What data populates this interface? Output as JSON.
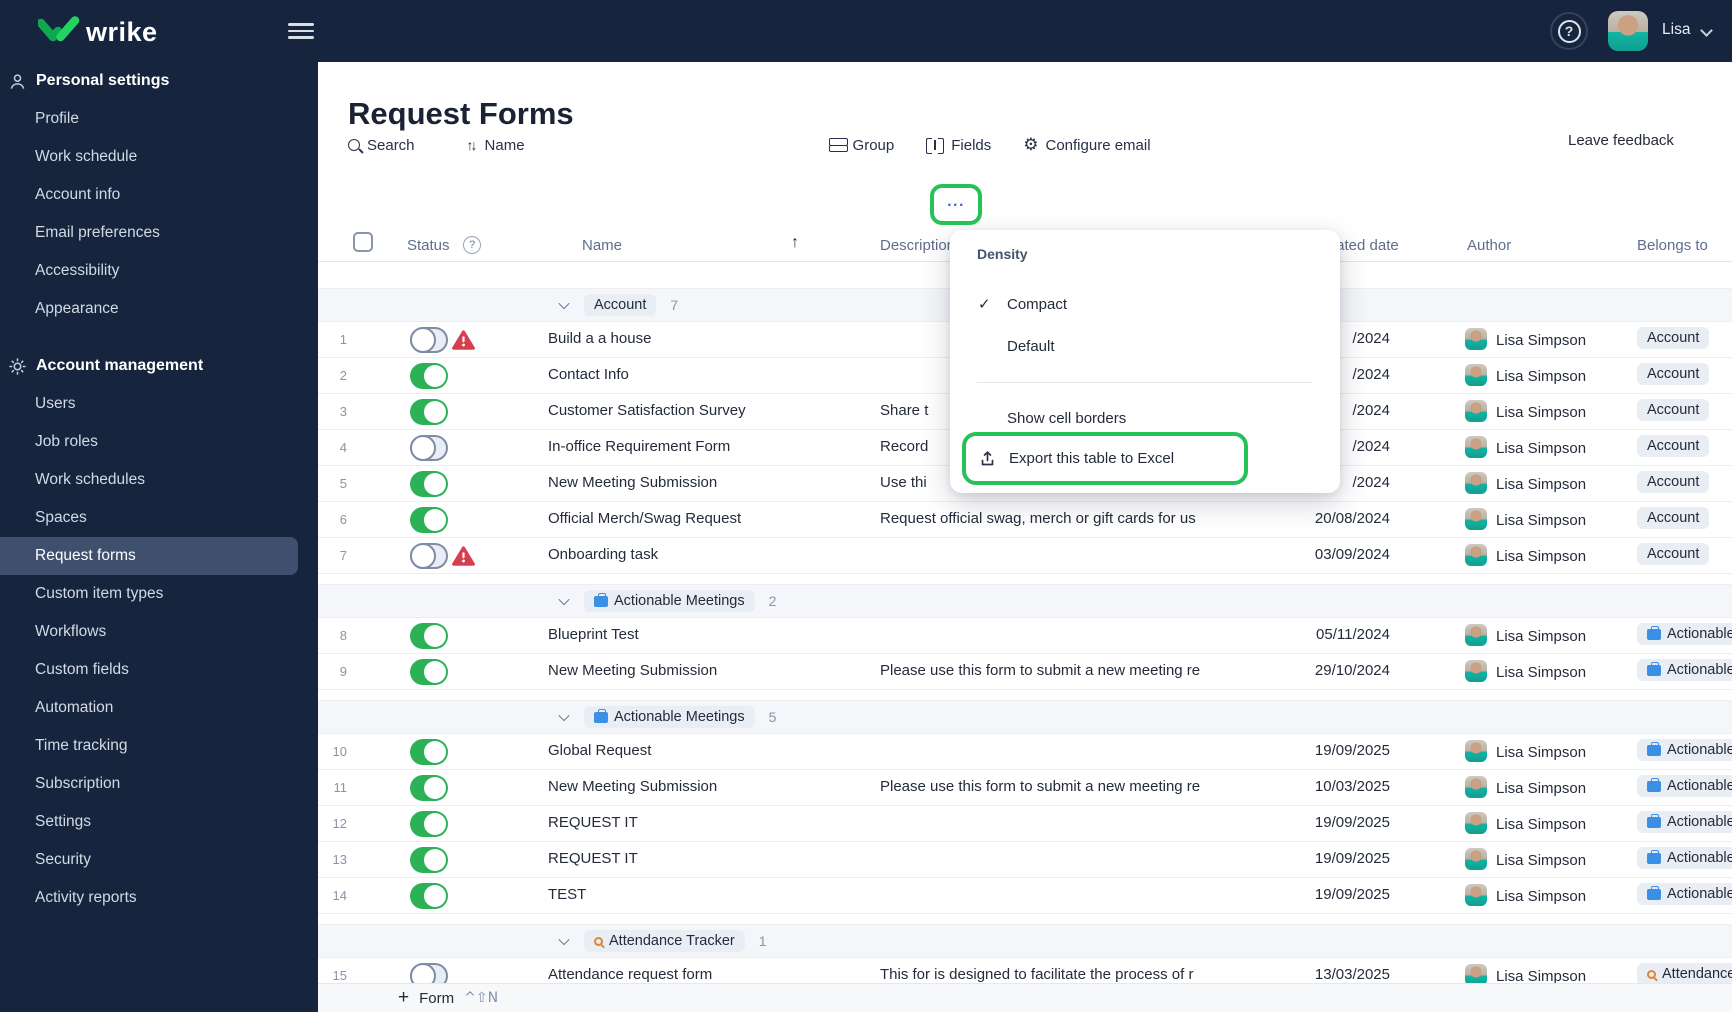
{
  "app": {
    "brand": "wrike",
    "user": {
      "name": "Lisa"
    }
  },
  "sidebar": {
    "sections": [
      {
        "label": "Personal settings",
        "icon": "person-icon",
        "items": [
          {
            "label": "Profile"
          },
          {
            "label": "Work schedule"
          },
          {
            "label": "Account info"
          },
          {
            "label": "Email preferences"
          },
          {
            "label": "Accessibility"
          },
          {
            "label": "Appearance"
          }
        ]
      },
      {
        "label": "Account management",
        "icon": "gear-icon",
        "items": [
          {
            "label": "Users"
          },
          {
            "label": "Job roles"
          },
          {
            "label": "Work schedules"
          },
          {
            "label": "Spaces"
          },
          {
            "label": "Request forms",
            "selected": true
          },
          {
            "label": "Custom item types"
          },
          {
            "label": "Workflows"
          },
          {
            "label": "Custom fields"
          },
          {
            "label": "Automation"
          },
          {
            "label": "Time tracking"
          },
          {
            "label": "Subscription"
          },
          {
            "label": "Settings"
          },
          {
            "label": "Security"
          },
          {
            "label": "Activity reports"
          }
        ]
      }
    ]
  },
  "main": {
    "title": "Request Forms",
    "toolbar": {
      "search": "Search",
      "sort": "Name",
      "group": "Group",
      "fields": "Fields",
      "configure_email": "Configure email",
      "more": "•••",
      "leave_feedback": "Leave feedback"
    },
    "table": {
      "headers": {
        "status": "Status",
        "name": "Name",
        "description": "Description",
        "created_date": "Created date",
        "author": "Author",
        "belongs_to": "Belongs to"
      },
      "groups": [
        {
          "name": "Account",
          "count": "7",
          "icon": null,
          "rows": [
            {
              "num": "1",
              "toggle": "off",
              "warning": true,
              "name": "Build a a house",
              "description": "",
              "date": "/2024",
              "author": "Lisa Simpson",
              "belongs": "Account"
            },
            {
              "num": "2",
              "toggle": "on",
              "warning": false,
              "name": "Contact Info",
              "description": "",
              "date": "/2024",
              "author": "Lisa Simpson",
              "belongs": "Account"
            },
            {
              "num": "3",
              "toggle": "on",
              "warning": false,
              "name": "Customer Satisfaction Survey",
              "description": "Share t",
              "date": "/2024",
              "author": "Lisa Simpson",
              "belongs": "Account"
            },
            {
              "num": "4",
              "toggle": "off",
              "warning": false,
              "name": "In-office Requirement Form",
              "description": "Record",
              "date": "/2024",
              "author": "Lisa Simpson",
              "belongs": "Account"
            },
            {
              "num": "5",
              "toggle": "on",
              "warning": false,
              "name": "New Meeting Submission",
              "description": "Use thi",
              "date": "/2024",
              "author": "Lisa Simpson",
              "belongs": "Account"
            },
            {
              "num": "6",
              "toggle": "on",
              "warning": false,
              "name": "Official Merch/Swag Request",
              "description": "Request official swag, merch or gift cards for us",
              "date": "20/08/2024",
              "author": "Lisa Simpson",
              "belongs": "Account"
            },
            {
              "num": "7",
              "toggle": "off",
              "warning": true,
              "name": "Onboarding task",
              "description": "",
              "date": "03/09/2024",
              "author": "Lisa Simpson",
              "belongs": "Account"
            }
          ]
        },
        {
          "name": "Actionable Meetings",
          "count": "2",
          "icon": "briefcase-icon",
          "rows": [
            {
              "num": "8",
              "toggle": "on",
              "warning": false,
              "name": "Blueprint Test",
              "description": "",
              "date": "05/11/2024",
              "author": "Lisa Simpson",
              "belongs": "Actionable Meetings"
            },
            {
              "num": "9",
              "toggle": "on",
              "warning": false,
              "name": "New Meeting Submission",
              "description": "Please use this form to submit a new meeting re",
              "date": "29/10/2024",
              "author": "Lisa Simpson",
              "belongs": "Actionable Meetings"
            }
          ]
        },
        {
          "name": "Actionable Meetings",
          "count": "5",
          "icon": "briefcase-icon",
          "rows": [
            {
              "num": "10",
              "toggle": "on",
              "warning": false,
              "name": "Global Request",
              "description": "",
              "date": "19/09/2025",
              "author": "Lisa Simpson",
              "belongs": "Actionable Meetings"
            },
            {
              "num": "11",
              "toggle": "on",
              "warning": false,
              "name": "New Meeting Submission",
              "description": "Please use this form to submit a new meeting re",
              "date": "10/03/2025",
              "author": "Lisa Simpson",
              "belongs": "Actionable Meetings"
            },
            {
              "num": "12",
              "toggle": "on",
              "warning": false,
              "name": "REQUEST IT",
              "description": "",
              "date": "19/09/2025",
              "author": "Lisa Simpson",
              "belongs": "Actionable Meetings"
            },
            {
              "num": "13",
              "toggle": "on",
              "warning": false,
              "name": "REQUEST IT",
              "description": "",
              "date": "19/09/2025",
              "author": "Lisa Simpson",
              "belongs": "Actionable Meetings"
            },
            {
              "num": "14",
              "toggle": "on",
              "warning": false,
              "name": "TEST",
              "description": "",
              "date": "19/09/2025",
              "author": "Lisa Simpson",
              "belongs": "Actionable Meetings"
            }
          ]
        },
        {
          "name": "Attendance Tracker",
          "count": "1",
          "icon": "magnifier-icon",
          "rows": [
            {
              "num": "15",
              "toggle": "off",
              "warning": false,
              "name": "Attendance request form",
              "description": "This for is designed to facilitate the process of r",
              "date": "13/03/2025",
              "author": "Lisa Simpson",
              "belongs": "Attendance Tracker"
            }
          ]
        }
      ]
    },
    "footer": {
      "add_label": "Form",
      "shortcut": "^⇧N"
    }
  },
  "context_menu": {
    "section_label": "Density",
    "density_options": [
      {
        "label": "Compact",
        "checked": true
      },
      {
        "label": "Default",
        "checked": false
      }
    ],
    "show_cell_borders": "Show cell borders",
    "export_excel": "Export this table to Excel"
  },
  "colors": {
    "navy": "#17243d",
    "selected_navy": "#3f4f6e",
    "accent_green": "#27c159",
    "toggle_green": "#2db157",
    "warning_red": "#d6404e",
    "briefcase_blue": "#3b8fe4",
    "magnifier_orange": "#de8638",
    "header_text": "#5e6e8c"
  }
}
